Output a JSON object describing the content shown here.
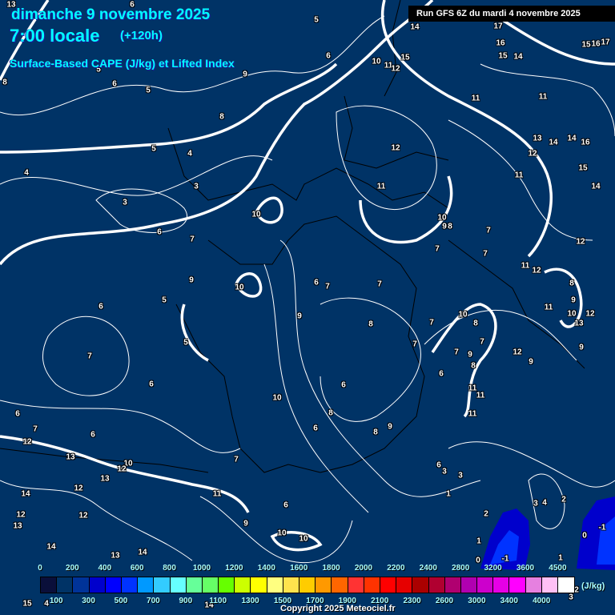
{
  "header": {
    "date": "dimanche 9 novembre 2025",
    "time": "7:00 locale",
    "lead": "(+120h)",
    "parameter": "Surface-Based CAPE (J/kg) et Lifted Index",
    "run": "Run GFS 6Z du mardi 4 novembre 2025"
  },
  "legend": {
    "unit": "(J/kg)",
    "top_labels": [
      "0",
      "200",
      "400",
      "600",
      "800",
      "1000",
      "1200",
      "1400",
      "1600",
      "1800",
      "2000",
      "2200",
      "2400",
      "2800",
      "3200",
      "3600",
      "4500"
    ],
    "bottom_labels": [
      "100",
      "300",
      "500",
      "700",
      "900",
      "1100",
      "1300",
      "1500",
      "1700",
      "1900",
      "2100",
      "2300",
      "2600",
      "3000",
      "3400",
      "4000"
    ],
    "colors": [
      "#0a0f3a",
      "#003366",
      "#003399",
      "#0000cc",
      "#0000ff",
      "#0033ff",
      "#0099ff",
      "#33ccff",
      "#66ffff",
      "#66ff99",
      "#66ff66",
      "#66ff00",
      "#ccff00",
      "#ffff00",
      "#ffff80",
      "#ffe34d",
      "#ffcc00",
      "#ff9900",
      "#ff6600",
      "#ff3333",
      "#ff3300",
      "#ff0000",
      "#e60000",
      "#aa0000",
      "#b00030",
      "#b00070",
      "#b000b0",
      "#cc00cc",
      "#e600e6",
      "#ff00ff",
      "#e680e0",
      "#ffc0f5",
      "#ffffff"
    ]
  },
  "lifted_index_labels": [
    "13",
    "6",
    "5",
    "6",
    "9",
    "5",
    "6",
    "5",
    "8",
    "8",
    "5",
    "4",
    "4",
    "3",
    "3",
    "6",
    "7",
    "10",
    "9",
    "10",
    "5",
    "5",
    "6",
    "7",
    "6",
    "6",
    "7",
    "6",
    "12",
    "13",
    "10",
    "12",
    "13",
    "12",
    "14",
    "12",
    "13",
    "12",
    "14",
    "13",
    "14",
    "11",
    "9",
    "6",
    "10",
    "10",
    "7",
    "6",
    "8",
    "6",
    "8",
    "9",
    "10",
    "9",
    "6",
    "7",
    "7",
    "8",
    "7",
    "12",
    "11",
    "10",
    "9",
    "8",
    "7",
    "7",
    "11",
    "12",
    "11",
    "11",
    "13",
    "14",
    "14",
    "16",
    "12",
    "11",
    "15",
    "14",
    "12",
    "17",
    "16",
    "15",
    "14",
    "15",
    "16",
    "17",
    "14",
    "10",
    "11",
    "12",
    "15",
    "8",
    "11",
    "9",
    "10",
    "12",
    "13",
    "9",
    "10",
    "8",
    "7",
    "7",
    "7",
    "9",
    "8",
    "6",
    "12",
    "9",
    "11",
    "11",
    "11",
    "7",
    "6",
    "3",
    "3",
    "1",
    "2",
    "3",
    "4",
    "2",
    "1",
    "0",
    "-1",
    "0",
    "-1",
    "1",
    "3",
    "2",
    "15",
    "4",
    "14"
  ],
  "copyright": "Copyright 2025 Meteociel.fr",
  "colors": {
    "background": "#003366",
    "title": "#00ffff",
    "contour": "#ffffff",
    "cape_low": "#0000cc",
    "cape_mid": "#0033ff"
  }
}
